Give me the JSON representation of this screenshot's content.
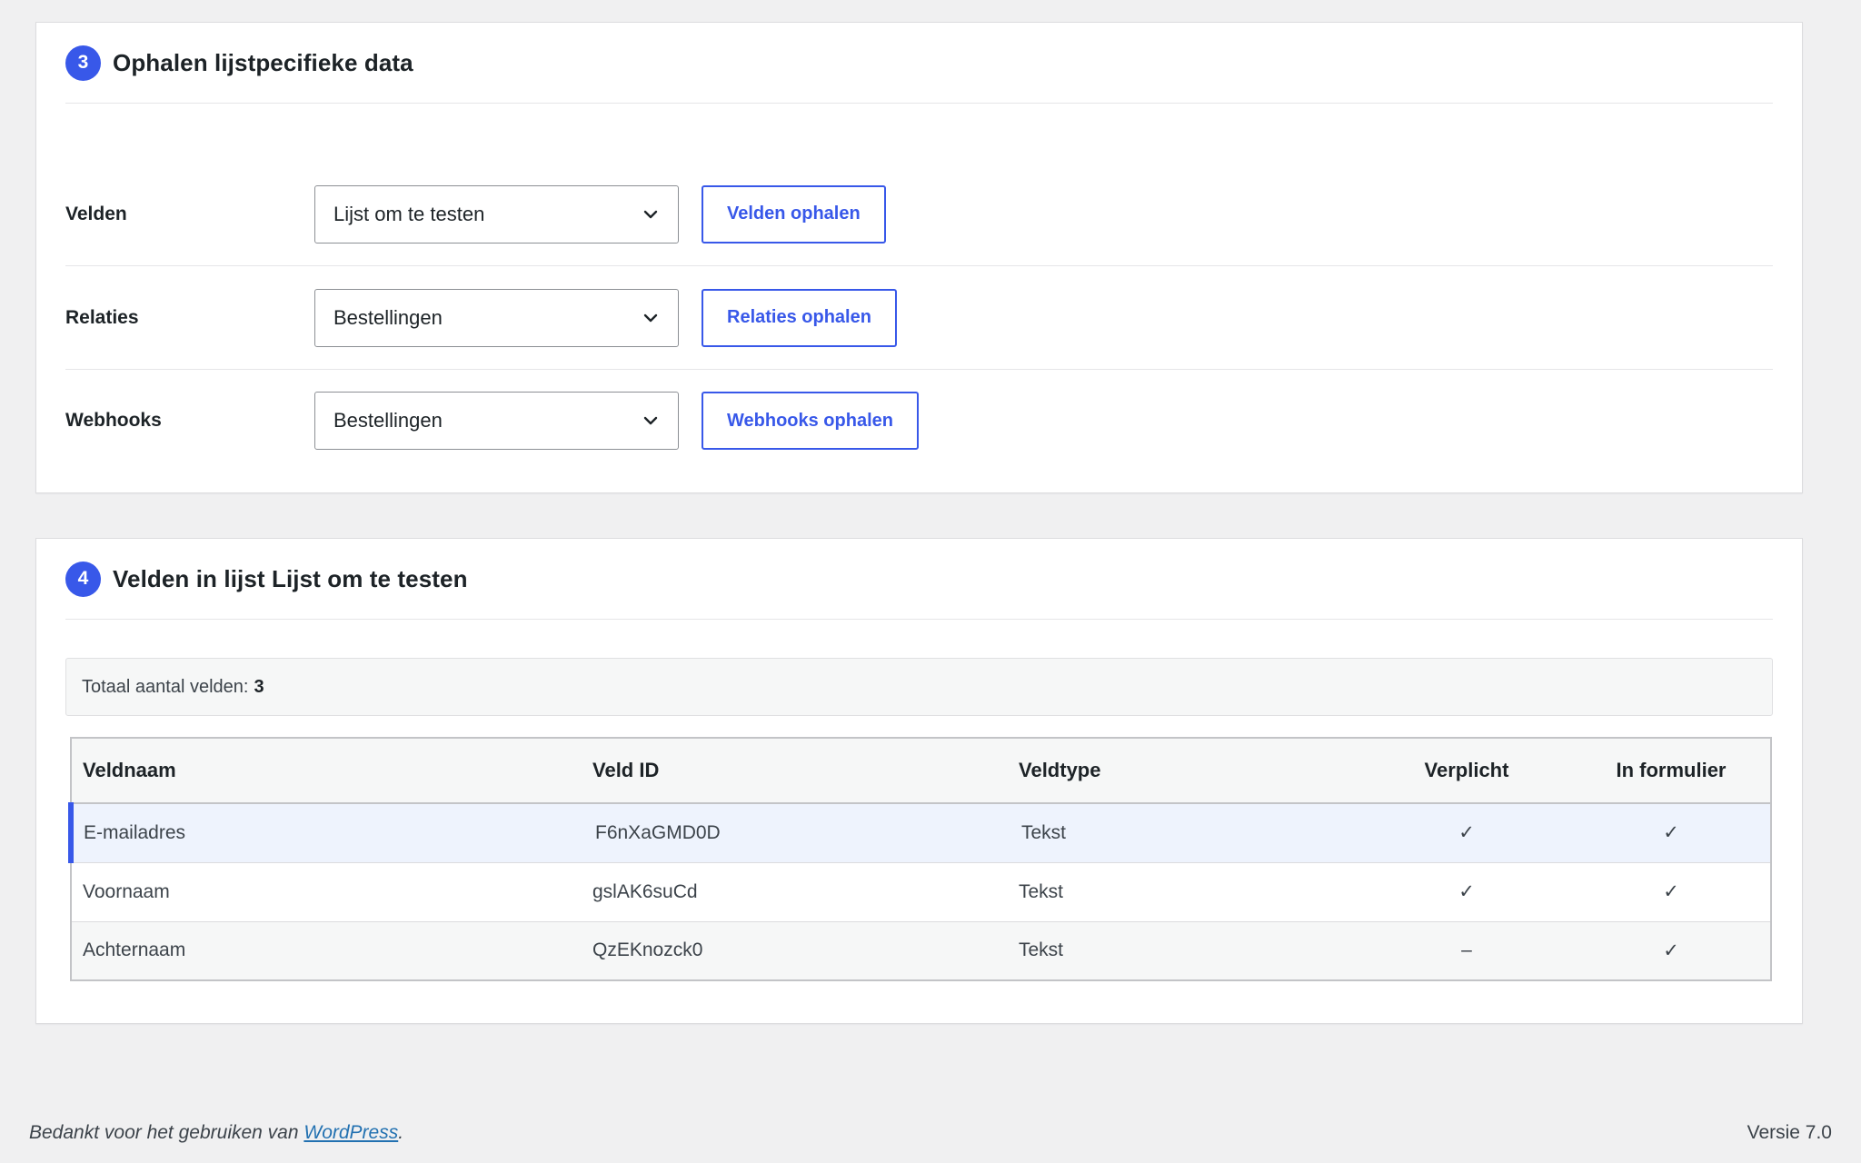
{
  "section3": {
    "step": "3",
    "title": "Ophalen lijstpecifieke data",
    "rows": [
      {
        "label": "Velden",
        "select_value": "Lijst om te testen",
        "button": "Velden ophalen"
      },
      {
        "label": "Relaties",
        "select_value": "Bestellingen",
        "button": "Relaties ophalen"
      },
      {
        "label": "Webhooks",
        "select_value": "Bestellingen",
        "button": "Webhooks ophalen"
      }
    ]
  },
  "section4": {
    "step": "4",
    "title": "Velden in lijst Lijst om te testen",
    "total_label": "Totaal aantal velden:",
    "total_value": "3",
    "table": {
      "headers": [
        "Veldnaam",
        "Veld ID",
        "Veldtype",
        "Verplicht",
        "In formulier"
      ],
      "rows": [
        {
          "name": "E-mailadres",
          "id": "F6nXaGMD0D",
          "type": "Tekst",
          "required": "✓",
          "in_form": "✓"
        },
        {
          "name": "Voornaam",
          "id": "gslAK6suCd",
          "type": "Tekst",
          "required": "✓",
          "in_form": "✓"
        },
        {
          "name": "Achternaam",
          "id": "QzEKnozck0",
          "type": "Tekst",
          "required": "–",
          "in_form": "✓"
        }
      ]
    }
  },
  "footer": {
    "thanks_prefix": "Bedankt voor het gebruiken van ",
    "link_text": "WordPress",
    "thanks_suffix": ".",
    "version": "Versie 7.0"
  },
  "colors": {
    "accent": "#3858e9",
    "background": "#f0f0f1",
    "selected_row": "#eef3fd"
  },
  "icons": {
    "select_arrow": "chevron-down-icon",
    "checkmark": "check-icon"
  }
}
